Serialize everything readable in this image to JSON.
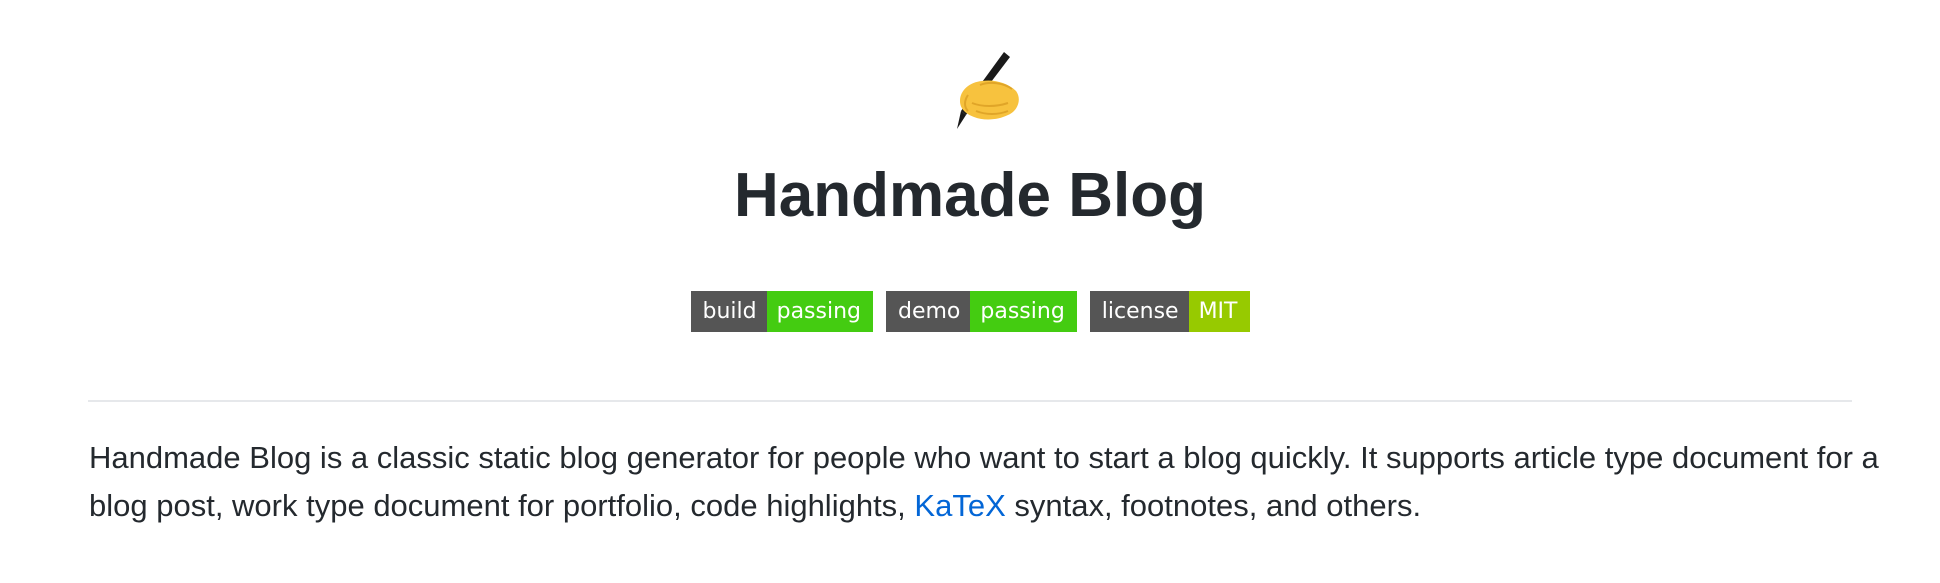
{
  "header": {
    "icon": "writing-hand-icon",
    "title": "Handmade Blog"
  },
  "badges": [
    {
      "label": "build",
      "value": "passing",
      "value_color": "#44cc11"
    },
    {
      "label": "demo",
      "value": "passing",
      "value_color": "#44cc11"
    },
    {
      "label": "license",
      "value": "MIT",
      "value_color": "#97ca00"
    }
  ],
  "description": {
    "before_link": "Handmade Blog is a classic static blog generator for people who want to start a blog quickly. It supports article type document for a blog post, work type document for portfolio, code highlights, ",
    "link_text": "KaTeX",
    "after_link": " syntax, footnotes, and others."
  },
  "colors": {
    "badge_label_bg": "#555555",
    "link": "#0366d6",
    "text": "#24292e"
  }
}
